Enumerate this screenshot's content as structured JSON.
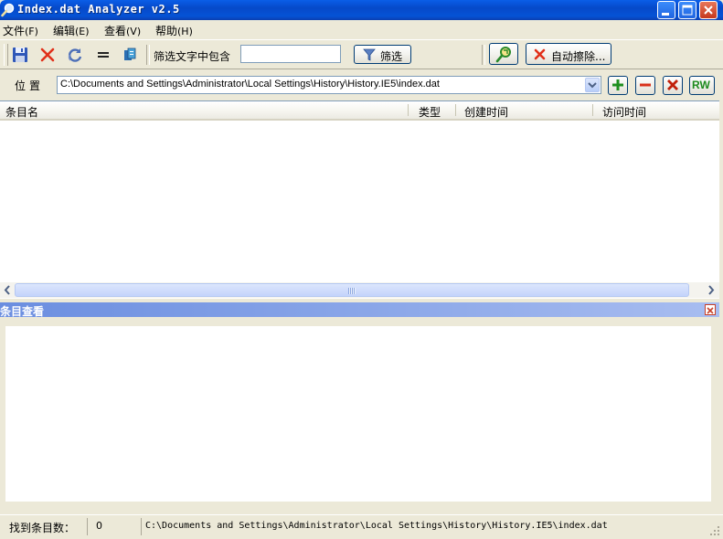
{
  "window": {
    "title": "Index.dat Analyzer v2.5"
  },
  "menu": {
    "items": [
      {
        "label": "文件",
        "accel": "(F)"
      },
      {
        "label": "编辑",
        "accel": "(E)"
      },
      {
        "label": "查看",
        "accel": "(V)"
      },
      {
        "label": "帮助",
        "accel": "(H)"
      }
    ]
  },
  "toolbar": {
    "icons": [
      "save-icon",
      "delete-icon",
      "refresh-icon",
      "equals-icon",
      "copy-icon"
    ],
    "filter_label": "筛选文字中包含",
    "filter_value": "",
    "filter_button": "筛选",
    "auto_erase_button": "自动擦除..."
  },
  "location": {
    "label": "位置",
    "path": "C:\\Documents and Settings\\Administrator\\Local Settings\\History\\History.IE5\\index.dat",
    "rw_label": "RW"
  },
  "list": {
    "columns": [
      "条目名",
      "类型",
      "创建时间",
      "访问时间"
    ],
    "rows": []
  },
  "detail_pane": {
    "title": "条目查看",
    "content": ""
  },
  "status": {
    "found_label": "找到条目数：",
    "found_count": "0",
    "path": "C:\\Documents and Settings\\Administrator\\Local Settings\\History\\History.IE5\\index.dat"
  },
  "colors": {
    "titlebar": "#0553d6",
    "face": "#ece9d8",
    "pane_title": "#6b8ee0",
    "rw_green": "#1d8a1d"
  }
}
